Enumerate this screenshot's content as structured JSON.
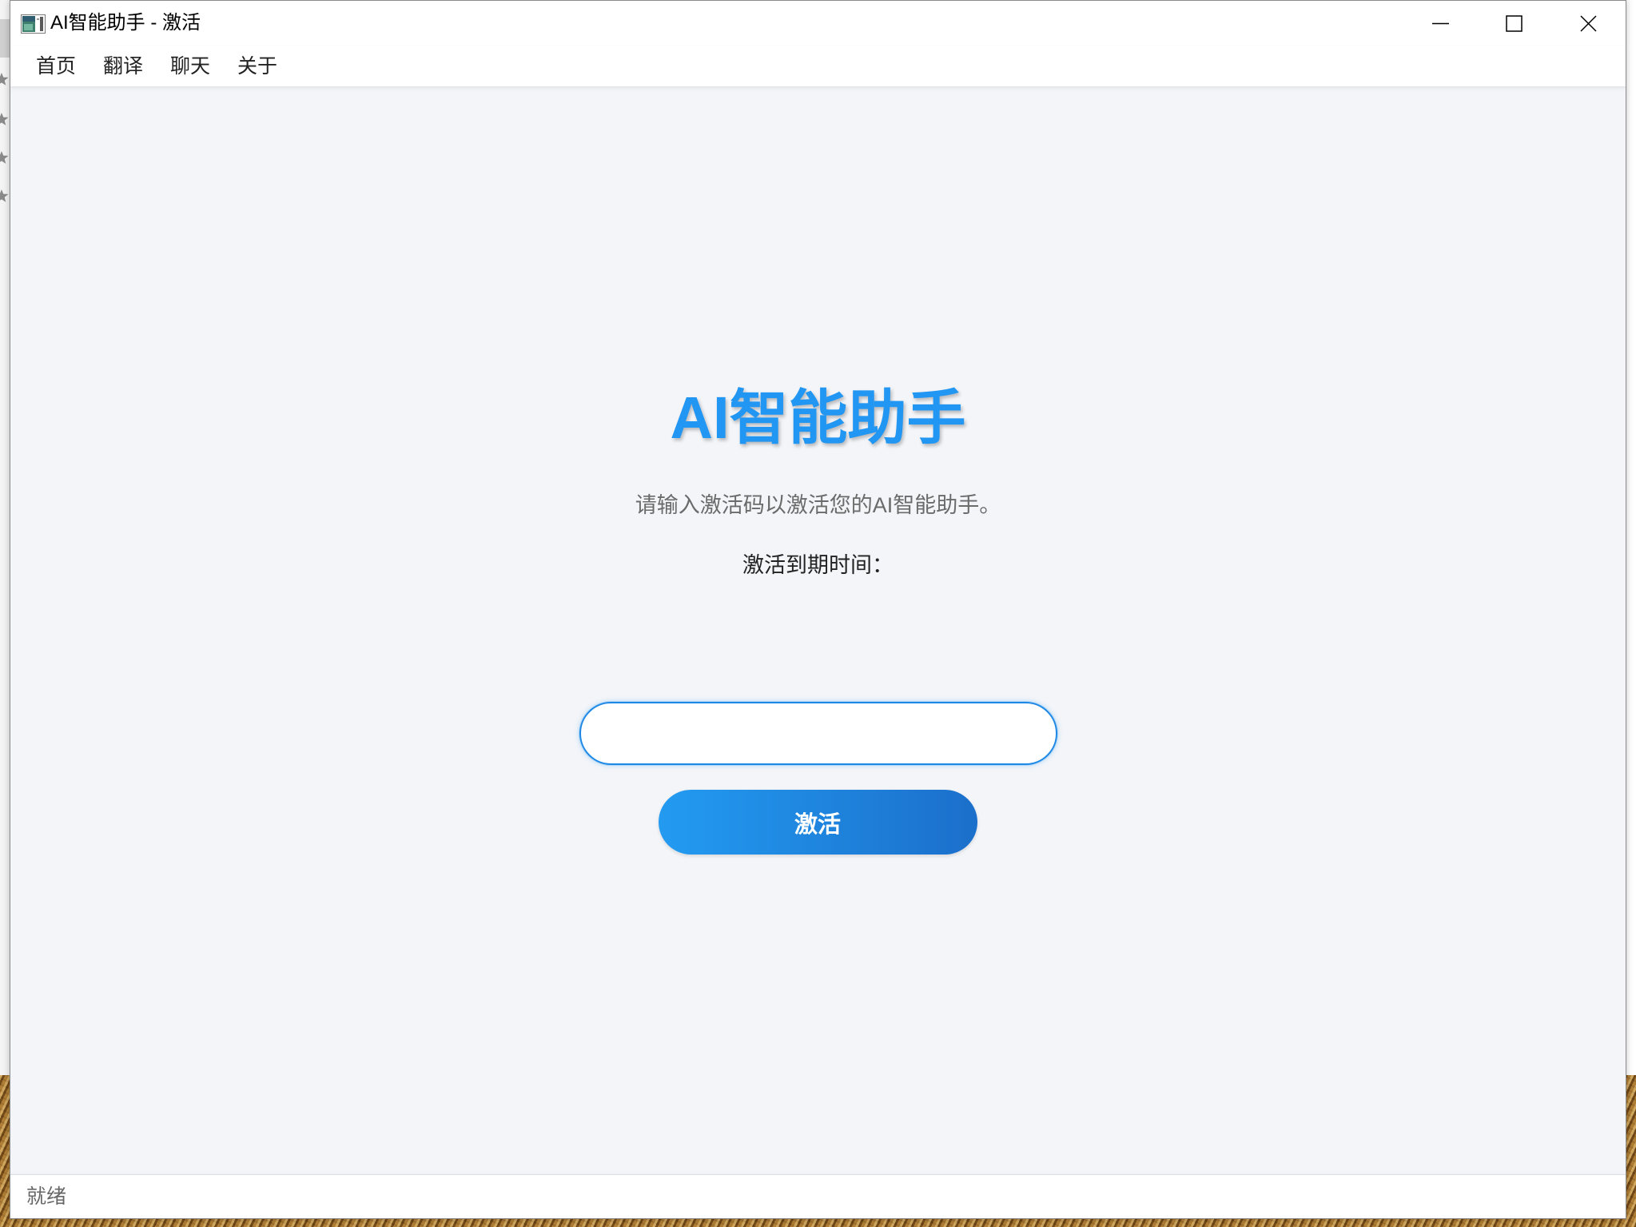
{
  "window": {
    "title": "AI智能助手 - 激活",
    "app_icon": "app-window-icon",
    "controls": {
      "minimize_icon": "minimize-icon",
      "maximize_icon": "maximize-icon",
      "close_icon": "close-icon"
    }
  },
  "menu": {
    "items": [
      {
        "label": "首页"
      },
      {
        "label": "翻译"
      },
      {
        "label": "聊天"
      },
      {
        "label": "关于"
      }
    ]
  },
  "main": {
    "heading": "AI智能助手",
    "subtitle": "请输入激活码以激活您的AI智能助手。",
    "expiry_label": "激活到期时间：",
    "activation_code_input": {
      "value": ""
    },
    "activate_button": {
      "label": "激活"
    }
  },
  "status_bar": {
    "text": "就绪"
  },
  "background_window": {
    "icons": [
      "star-icon",
      "star-icon",
      "star-icon",
      "star-icon"
    ]
  },
  "colors": {
    "accent": "#2196f3",
    "input_border": "#1e88e5",
    "button_gradient_start": "#239bf1",
    "button_gradient_end": "#1b6fcb",
    "content_background": "#f3f5f9"
  }
}
